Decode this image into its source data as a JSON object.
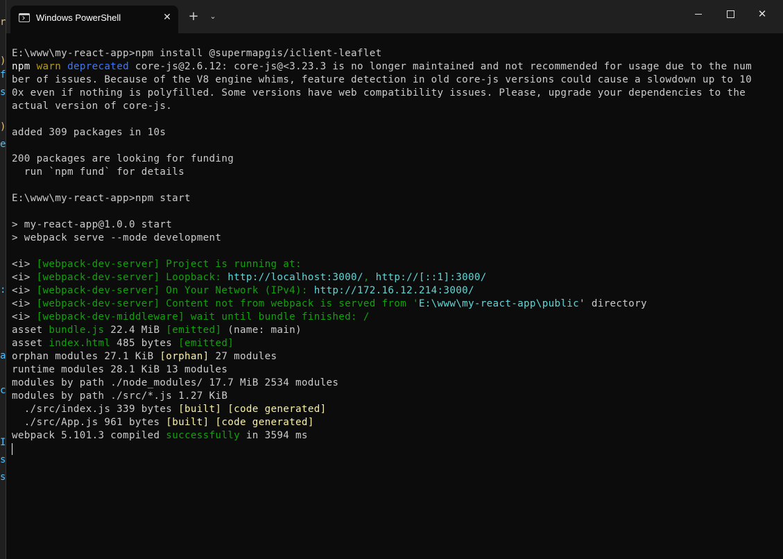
{
  "window": {
    "tab_title": "Windows PowerShell",
    "tab_close": "✕",
    "new_tab": "+",
    "dropdown": "⌄",
    "close": "✕"
  },
  "bleed": [
    "r",
    ")",
    "f",
    "s",
    ")",
    "e",
    ":",
    "a",
    "c",
    "I",
    "s",
    "s"
  ],
  "terminal": {
    "lines": [
      [
        {
          "t": "E:\\www\\my-react-app>npm install @supermapgis/iclient-leaflet",
          "c": "default"
        }
      ],
      [
        {
          "t": "npm ",
          "c": "white"
        },
        {
          "t": "warn",
          "c": "yellow"
        },
        {
          "t": " ",
          "c": "default"
        },
        {
          "t": "deprecated",
          "c": "blue"
        },
        {
          "t": " core-js@2.6.12: core-js@<3.23.3 is no longer maintained and not recommended for usage due to the num",
          "c": "default"
        }
      ],
      [
        {
          "t": "ber of issues. Because of the V8 engine whims, feature detection in old core-js versions could cause a slowdown up to 10",
          "c": "default"
        }
      ],
      [
        {
          "t": "0x even if nothing is polyfilled. Some versions have web compatibility issues. Please, upgrade your dependencies to the",
          "c": "default"
        }
      ],
      [
        {
          "t": "actual version of core-js.",
          "c": "default"
        }
      ],
      [],
      [
        {
          "t": "added 309 packages in 10s",
          "c": "default"
        }
      ],
      [],
      [
        {
          "t": "200 packages are looking for funding",
          "c": "default"
        }
      ],
      [
        {
          "t": "  run `npm fund` for details",
          "c": "default"
        }
      ],
      [],
      [
        {
          "t": "E:\\www\\my-react-app>npm start",
          "c": "default"
        }
      ],
      [],
      [
        {
          "t": "> my-react-app@1.0.0 start",
          "c": "default"
        }
      ],
      [
        {
          "t": "> webpack serve --mode development",
          "c": "default"
        }
      ],
      [],
      [
        {
          "t": "<i> ",
          "c": "default"
        },
        {
          "t": "[webpack-dev-server] Project is running at:",
          "c": "green"
        }
      ],
      [
        {
          "t": "<i> ",
          "c": "default"
        },
        {
          "t": "[webpack-dev-server] Loopback: ",
          "c": "green"
        },
        {
          "t": "http://localhost:3000/",
          "c": "cyan"
        },
        {
          "t": ", ",
          "c": "green"
        },
        {
          "t": "http://[::1]:3000/",
          "c": "cyan"
        }
      ],
      [
        {
          "t": "<i> ",
          "c": "default"
        },
        {
          "t": "[webpack-dev-server] On Your Network (IPv4): ",
          "c": "green"
        },
        {
          "t": "http://172.16.12.214:3000/",
          "c": "cyan"
        }
      ],
      [
        {
          "t": "<i> ",
          "c": "default"
        },
        {
          "t": "[webpack-dev-server] Content not from webpack is served from '",
          "c": "green"
        },
        {
          "t": "E:\\www\\my-react-app\\public",
          "c": "cyan"
        },
        {
          "t": "' directory",
          "c": "default"
        }
      ],
      [
        {
          "t": "<i> ",
          "c": "default"
        },
        {
          "t": "[webpack-dev-middleware] wait until bundle finished: /",
          "c": "green"
        }
      ],
      [
        {
          "t": "asset ",
          "c": "default"
        },
        {
          "t": "bundle.js",
          "c": "green"
        },
        {
          "t": " 22.4 MiB ",
          "c": "default"
        },
        {
          "t": "[emitted]",
          "c": "green"
        },
        {
          "t": " (name: main)",
          "c": "default"
        }
      ],
      [
        {
          "t": "asset ",
          "c": "default"
        },
        {
          "t": "index.html",
          "c": "green"
        },
        {
          "t": " 485 bytes ",
          "c": "default"
        },
        {
          "t": "[emitted]",
          "c": "green"
        }
      ],
      [
        {
          "t": "orphan modules 27.1 KiB ",
          "c": "default"
        },
        {
          "t": "[orphan]",
          "c": "byellow"
        },
        {
          "t": " 27 modules",
          "c": "default"
        }
      ],
      [
        {
          "t": "runtime modules 28.1 KiB 13 modules",
          "c": "default"
        }
      ],
      [
        {
          "t": "modules by path ./node_modules/ 17.7 MiB 2534 modules",
          "c": "default"
        }
      ],
      [
        {
          "t": "modules by path ./src/*.js 1.27 KiB",
          "c": "default"
        }
      ],
      [
        {
          "t": "  ./src/index.js 339 bytes ",
          "c": "default"
        },
        {
          "t": "[built]",
          "c": "byellow"
        },
        {
          "t": " ",
          "c": "default"
        },
        {
          "t": "[code generated]",
          "c": "byellow"
        }
      ],
      [
        {
          "t": "  ./src/App.js 961 bytes ",
          "c": "default"
        },
        {
          "t": "[built]",
          "c": "byellow"
        },
        {
          "t": " ",
          "c": "default"
        },
        {
          "t": "[code generated]",
          "c": "byellow"
        }
      ],
      [
        {
          "t": "webpack 5.101.3 compiled ",
          "c": "default"
        },
        {
          "t": "successfully",
          "c": "green"
        },
        {
          "t": " in 3594 ms",
          "c": "default"
        }
      ]
    ]
  }
}
